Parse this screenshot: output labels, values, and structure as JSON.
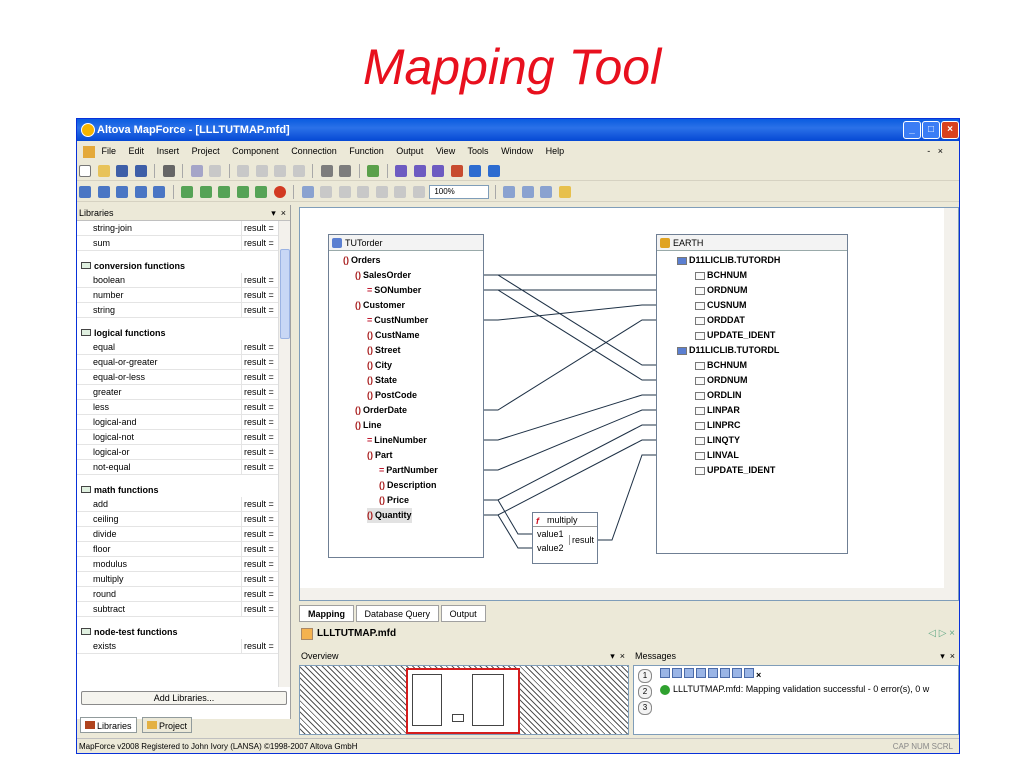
{
  "slide": {
    "title": "Mapping Tool"
  },
  "window": {
    "title": "Altova MapForce - [LLLTUTMAP.mfd]",
    "menu": [
      "File",
      "Edit",
      "Insert",
      "Project",
      "Component",
      "Connection",
      "Function",
      "Output",
      "View",
      "Tools",
      "Window",
      "Help"
    ],
    "mdi_controls": "-   ×",
    "zoom": "100%"
  },
  "libraries": {
    "header": "Libraries",
    "header_ctrl": "▾  ×",
    "rows_top": [
      {
        "name": "string-join",
        "result": "result ="
      },
      {
        "name": "sum",
        "result": "result ="
      }
    ],
    "groups": [
      {
        "title": "conversion functions",
        "items": [
          {
            "name": "boolean",
            "result": "result ="
          },
          {
            "name": "number",
            "result": "result ="
          },
          {
            "name": "string",
            "result": "result ="
          }
        ]
      },
      {
        "title": "logical functions",
        "items": [
          {
            "name": "equal",
            "result": "result ="
          },
          {
            "name": "equal-or-greater",
            "result": "result ="
          },
          {
            "name": "equal-or-less",
            "result": "result ="
          },
          {
            "name": "greater",
            "result": "result ="
          },
          {
            "name": "less",
            "result": "result ="
          },
          {
            "name": "logical-and",
            "result": "result ="
          },
          {
            "name": "logical-not",
            "result": "result ="
          },
          {
            "name": "logical-or",
            "result": "result ="
          },
          {
            "name": "not-equal",
            "result": "result ="
          }
        ]
      },
      {
        "title": "math functions",
        "items": [
          {
            "name": "add",
            "result": "result ="
          },
          {
            "name": "ceiling",
            "result": "result ="
          },
          {
            "name": "divide",
            "result": "result ="
          },
          {
            "name": "floor",
            "result": "result ="
          },
          {
            "name": "modulus",
            "result": "result ="
          },
          {
            "name": "multiply",
            "result": "result ="
          },
          {
            "name": "round",
            "result": "result ="
          },
          {
            "name": "subtract",
            "result": "result ="
          }
        ]
      },
      {
        "title": "node-test functions",
        "items": [
          {
            "name": "exists",
            "result": "result ="
          }
        ]
      }
    ],
    "add_button": "Add Libraries...",
    "tabs": [
      "Libraries",
      "Project"
    ]
  },
  "source": {
    "title": "TUTorder",
    "nodes": [
      "Orders",
      "SalesOrder",
      "SONumber",
      "Customer",
      "CustNumber",
      "CustName",
      "Street",
      "City",
      "State",
      "PostCode",
      "OrderDate",
      "Line",
      "LineNumber",
      "Part",
      "PartNumber",
      "Description",
      "Price",
      "Quantity"
    ]
  },
  "target": {
    "title": "EARTH",
    "nodes": [
      "D11LICLIB.TUTORDH",
      "BCHNUM",
      "ORDNUM",
      "CUSNUM",
      "ORDDAT",
      "UPDATE_IDENT",
      "D11LICLIB.TUTORDL",
      "BCHNUM",
      "ORDNUM",
      "ORDLIN",
      "LINPAR",
      "LINPRC",
      "LINQTY",
      "LINVAL",
      "UPDATE_IDENT"
    ]
  },
  "multiply": {
    "title": "multiply",
    "in1": "value1",
    "in2": "value2",
    "out": "result"
  },
  "mapping_tabs": [
    "Mapping",
    "Database Query",
    "Output"
  ],
  "file_tab": "LLLTUTMAP.mfd",
  "file_nav": "◁ ▷ ×",
  "overview": {
    "title": "Overview",
    "ctrl": "▾  ×"
  },
  "messages": {
    "title": "Messages",
    "ctrl": "▾  ×",
    "text": "LLLTUTMAP.mfd: Mapping validation successful - 0 error(s), 0 w",
    "side": [
      "1",
      "2",
      "3"
    ]
  },
  "status": {
    "left": "MapForce v2008   Registered to John Ivory (LANSA)  ©1998-2007 Altova GmbH",
    "right": "CAP  NUM  SCRL"
  }
}
